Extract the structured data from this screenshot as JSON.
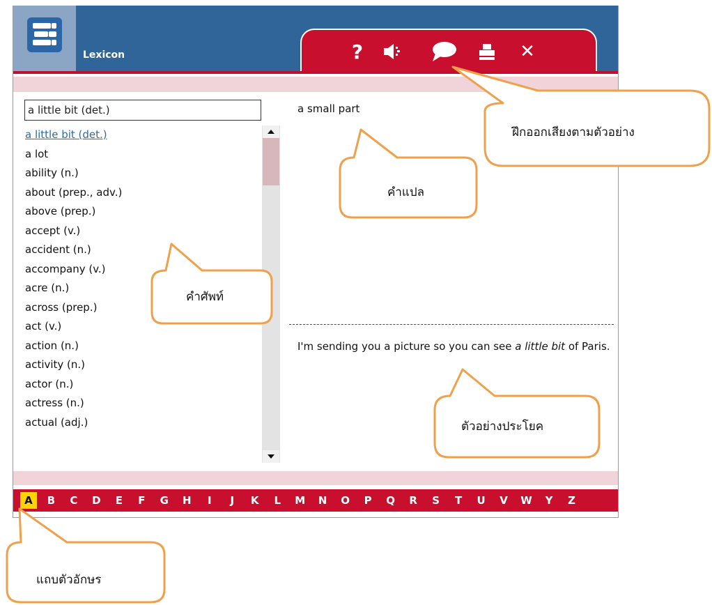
{
  "app": {
    "title": "Lexicon"
  },
  "toolbar": {
    "help_label": "?",
    "close_label": "✕",
    "icons": [
      "help-icon",
      "speaker-icon",
      "speech-bubble-icon",
      "print-icon",
      "close-icon"
    ]
  },
  "search": {
    "value": "a little bit (det.)"
  },
  "word_list": {
    "selected_index": 0,
    "items": [
      "a little bit (det.)",
      "a lot",
      "ability (n.)",
      "about (prep., adv.)",
      "above (prep.)",
      "accept (v.)",
      "accident (n.)",
      "accompany (v.)",
      "acre (n.)",
      "across (prep.)",
      "act (v.)",
      "action (n.)",
      "activity (n.)",
      "actor (n.)",
      "actress (n.)",
      "actual (adj.)"
    ]
  },
  "entry": {
    "translation": "a small part",
    "example_before": "I'm sending you a picture so you can see ",
    "example_highlight": "a little bit",
    "example_after": " of Paris."
  },
  "alphabet": {
    "active": "A",
    "letters": [
      "A",
      "B",
      "C",
      "D",
      "E",
      "F",
      "G",
      "H",
      "I",
      "J",
      "K",
      "L",
      "M",
      "N",
      "O",
      "P",
      "Q",
      "R",
      "S",
      "T",
      "U",
      "V",
      "W",
      "Y",
      "Z"
    ]
  },
  "callouts": {
    "speak_practice": "ฝึกออกเสียงตามตัวอย่าง",
    "translation": "คำแปล",
    "vocabulary": "คำศัพท์",
    "example_sentence": "ตัวอย่างประโยค",
    "letter_bar": "แถบตัวอักษร"
  },
  "colors": {
    "title_bar": "#2f6598",
    "toolbar_red": "#c8102e",
    "pink_bar": "#f0d4da",
    "link_blue": "#2e6aa6",
    "active_letter": "#ffd400",
    "callout_border": "#f0a04b"
  }
}
